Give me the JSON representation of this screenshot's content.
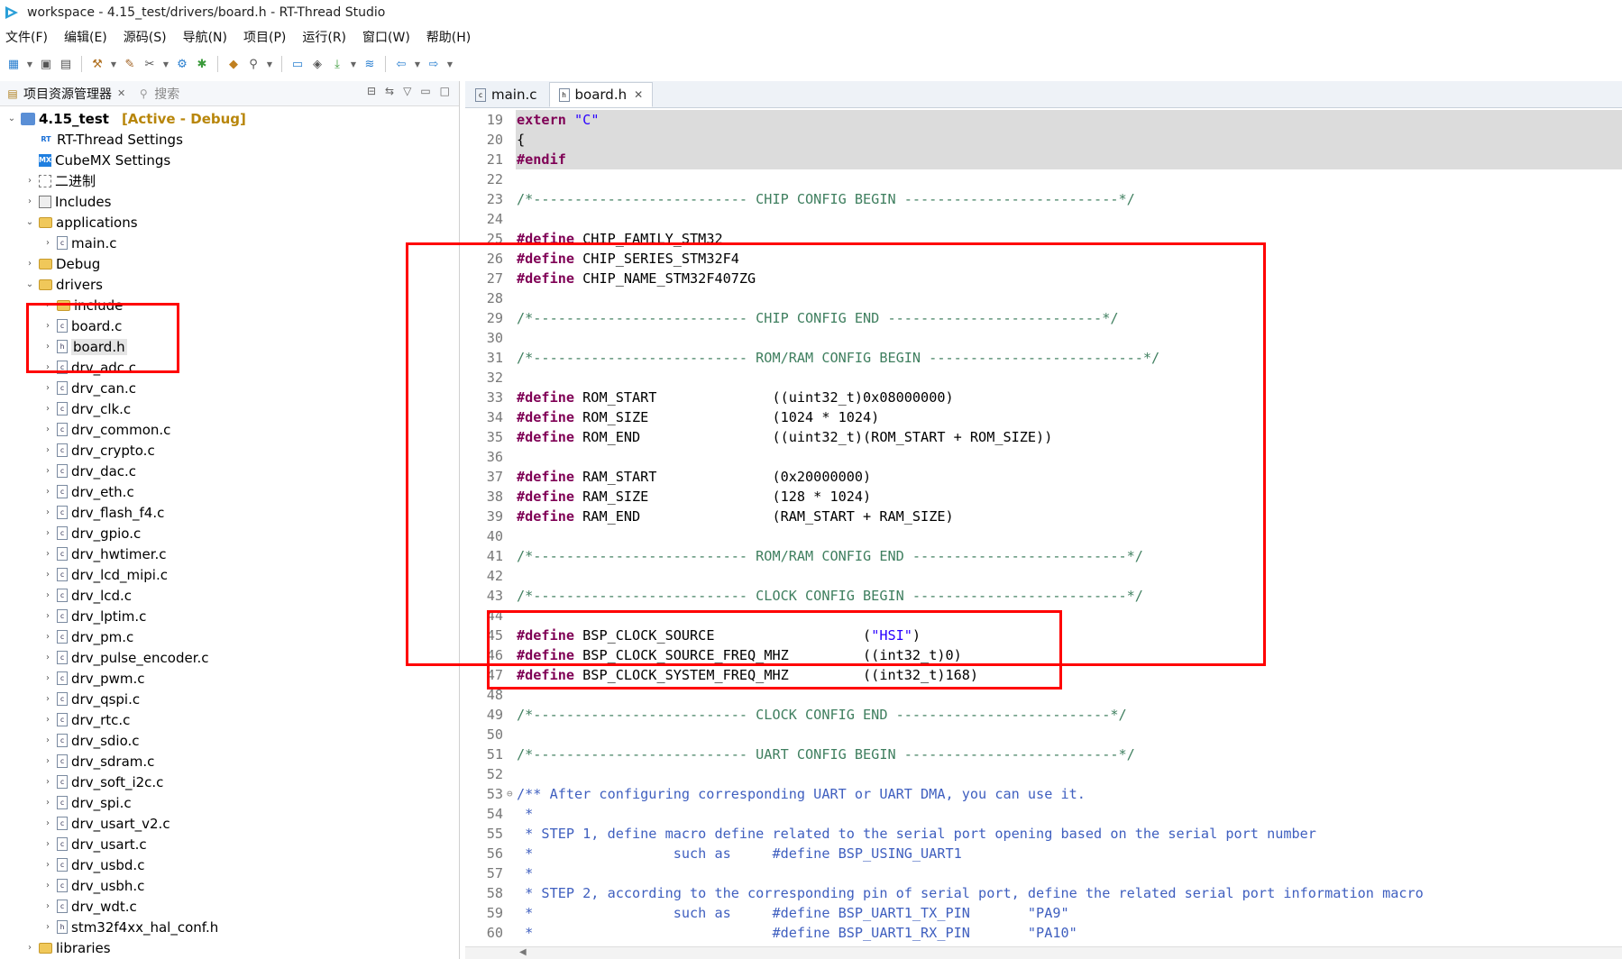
{
  "window": {
    "title": "workspace - 4.15_test/drivers/board.h - RT-Thread Studio"
  },
  "menubar": [
    "文件(F)",
    "编辑(E)",
    "源码(S)",
    "导航(N)",
    "项目(P)",
    "运行(R)",
    "窗口(W)",
    "帮助(H)"
  ],
  "toolbar": {
    "icons": [
      "new-icon",
      "save-icon",
      "save-all-icon",
      "build-icon",
      "wrench-icon",
      "tools-icon",
      "cpu-icon",
      "debug-icon",
      "package-icon",
      "search-icon",
      "terminal-icon",
      "chip-icon",
      "download-icon",
      "sdk-icon",
      "back-icon",
      "forward-icon"
    ]
  },
  "explorer": {
    "tabs": [
      {
        "label": "项目资源管理器",
        "icon": "explorer-icon",
        "close": "✕"
      },
      {
        "label": "搜索",
        "icon": "search-icon"
      }
    ],
    "project": {
      "name": "4.15_test",
      "tag": "[Active - Debug]"
    },
    "items": [
      {
        "label": "RT-Thread Settings",
        "icon": "rt-settings-icon"
      },
      {
        "label": "CubeMX Settings",
        "icon": "cubemx-icon"
      },
      {
        "label": "二进制",
        "icon": "binaries-icon"
      },
      {
        "label": "Includes",
        "icon": "includes-icon"
      },
      {
        "label": "applications",
        "icon": "folder-icon"
      },
      {
        "label": "main.c",
        "icon": "c-file-icon"
      },
      {
        "label": "Debug",
        "icon": "folder-icon"
      },
      {
        "label": "drivers",
        "icon": "folder-icon"
      }
    ],
    "driver_files": [
      "include",
      "board.c",
      "board.h",
      "drv_adc.c",
      "drv_can.c",
      "drv_clk.c",
      "drv_common.c",
      "drv_crypto.c",
      "drv_dac.c",
      "drv_eth.c",
      "drv_flash_f4.c",
      "drv_gpio.c",
      "drv_hwtimer.c",
      "drv_lcd_mipi.c",
      "drv_lcd.c",
      "drv_lptim.c",
      "drv_pm.c",
      "drv_pulse_encoder.c",
      "drv_pwm.c",
      "drv_qspi.c",
      "drv_rtc.c",
      "drv_sdio.c",
      "drv_sdram.c",
      "drv_soft_i2c.c",
      "drv_spi.c",
      "drv_usart_v2.c",
      "drv_usart.c",
      "drv_usbd.c",
      "drv_usbh.c",
      "drv_wdt.c",
      "stm32f4xx_hal_conf.h"
    ],
    "libraries": "libraries"
  },
  "editor": {
    "tabs": [
      {
        "label": "main.c",
        "active": false
      },
      {
        "label": "board.h",
        "active": true,
        "close": "✕"
      }
    ],
    "lines": [
      {
        "n": "19",
        "t": "extern \"C\"",
        "hl": true
      },
      {
        "n": "20",
        "t": "{",
        "hl": true
      },
      {
        "n": "21",
        "t": "#endif",
        "hl": true
      },
      {
        "n": "22",
        "t": ""
      },
      {
        "n": "23",
        "t": "/*-------------------------- CHIP CONFIG BEGIN --------------------------*/"
      },
      {
        "n": "24",
        "t": ""
      },
      {
        "n": "25",
        "t": "#define CHIP_FAMILY_STM32"
      },
      {
        "n": "26",
        "t": "#define CHIP_SERIES_STM32F4"
      },
      {
        "n": "27",
        "t": "#define CHIP_NAME_STM32F407ZG"
      },
      {
        "n": "28",
        "t": ""
      },
      {
        "n": "29",
        "t": "/*-------------------------- CHIP CONFIG END --------------------------*/"
      },
      {
        "n": "30",
        "t": ""
      },
      {
        "n": "31",
        "t": "/*-------------------------- ROM/RAM CONFIG BEGIN --------------------------*/"
      },
      {
        "n": "32",
        "t": ""
      },
      {
        "n": "33",
        "t": "#define ROM_START              ((uint32_t)0x08000000)"
      },
      {
        "n": "34",
        "t": "#define ROM_SIZE               (1024 * 1024)"
      },
      {
        "n": "35",
        "t": "#define ROM_END                ((uint32_t)(ROM_START + ROM_SIZE))"
      },
      {
        "n": "36",
        "t": ""
      },
      {
        "n": "37",
        "t": "#define RAM_START              (0x20000000)"
      },
      {
        "n": "38",
        "t": "#define RAM_SIZE               (128 * 1024)"
      },
      {
        "n": "39",
        "t": "#define RAM_END                (RAM_START + RAM_SIZE)"
      },
      {
        "n": "40",
        "t": ""
      },
      {
        "n": "41",
        "t": "/*-------------------------- ROM/RAM CONFIG END --------------------------*/"
      },
      {
        "n": "42",
        "t": ""
      },
      {
        "n": "43",
        "t": "/*-------------------------- CLOCK CONFIG BEGIN --------------------------*/"
      },
      {
        "n": "44",
        "t": ""
      },
      {
        "n": "45",
        "t": "#define BSP_CLOCK_SOURCE                  (\"HSI\")"
      },
      {
        "n": "46",
        "t": "#define BSP_CLOCK_SOURCE_FREQ_MHZ         ((int32_t)0)"
      },
      {
        "n": "47",
        "t": "#define BSP_CLOCK_SYSTEM_FREQ_MHZ         ((int32_t)168)"
      },
      {
        "n": "48",
        "t": ""
      },
      {
        "n": "49",
        "t": "/*-------------------------- CLOCK CONFIG END --------------------------*/"
      },
      {
        "n": "50",
        "t": ""
      },
      {
        "n": "51",
        "t": "/*-------------------------- UART CONFIG BEGIN --------------------------*/"
      },
      {
        "n": "52",
        "t": ""
      },
      {
        "n": "53",
        "t": "/** After configuring corresponding UART or UART DMA, you can use it.",
        "fold": "⊖"
      },
      {
        "n": "54",
        "t": " *"
      },
      {
        "n": "55",
        "t": " * STEP 1, define macro define related to the serial port opening based on the serial port number"
      },
      {
        "n": "56",
        "t": " *                 such as     #define BSP_USING_UART1"
      },
      {
        "n": "57",
        "t": " *"
      },
      {
        "n": "58",
        "t": " * STEP 2, according to the corresponding pin of serial port, define the related serial port information macro"
      },
      {
        "n": "59",
        "t": " *                 such as     #define BSP_UART1_TX_PIN       \"PA9\""
      },
      {
        "n": "60",
        "t": " *                             #define BSP_UART1_RX_PIN       \"PA10\""
      }
    ]
  },
  "colors": {
    "keyword": "#7f0055",
    "string": "#2a00ff",
    "comment": "#3f7f5f",
    "doc_comment": "#3f5fbf",
    "annotation": "#ff0000"
  }
}
